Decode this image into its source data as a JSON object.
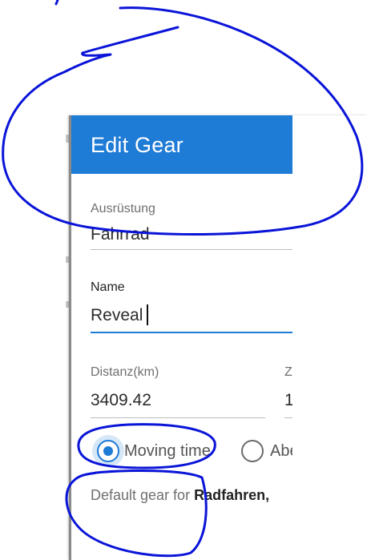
{
  "dialog": {
    "title": "Edit Gear",
    "header_color": "#1e7bd6"
  },
  "fields": {
    "type": {
      "label": "Ausrüstung",
      "value": "Fahrrad"
    },
    "name": {
      "label": "Name",
      "value": "Reveal"
    },
    "distance": {
      "label": "Distanz(km)",
      "value": "3409.42"
    },
    "second": {
      "label": "Z",
      "value": "1"
    }
  },
  "radios": {
    "moving_time": {
      "label": "Moving time",
      "selected": true
    },
    "other": {
      "label": "Abe",
      "selected": false
    }
  },
  "footer": {
    "prefix": "Default gear for ",
    "sport": "Radfahren",
    "suffix": ","
  },
  "annotation": {
    "color": "#0a14d8"
  }
}
